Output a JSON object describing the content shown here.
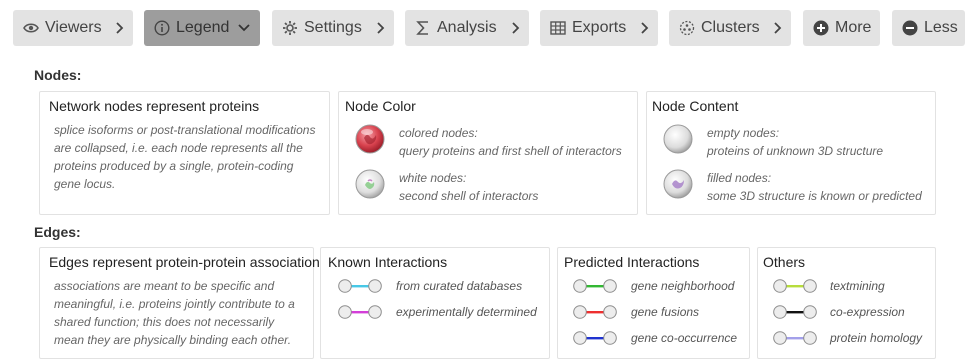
{
  "toolbar": {
    "buttons": [
      {
        "label": "Viewers",
        "icon": "eye-icon"
      },
      {
        "label": "Legend",
        "icon": "info-icon"
      },
      {
        "label": "Settings",
        "icon": "gear-icon"
      },
      {
        "label": "Analysis",
        "icon": "sigma-icon"
      },
      {
        "label": "Exports",
        "icon": "table-icon"
      },
      {
        "label": "Clusters",
        "icon": "cluster-icon"
      },
      {
        "label": "More",
        "icon": "plus-circle-icon"
      },
      {
        "label": "Less",
        "icon": "minus-circle-icon"
      }
    ],
    "active": "Legend"
  },
  "nodes": {
    "section_label": "Nodes:",
    "intro": {
      "title": "Network nodes represent proteins",
      "text": "splice isoforms or post-translational modifications are collapsed, i.e. each node represents all the proteins produced by a single, protein-coding gene locus."
    },
    "node_color": {
      "title": "Node Color",
      "items": [
        {
          "line1": "colored nodes:",
          "line2": "query proteins and first shell of interactors"
        },
        {
          "line1": "white nodes:",
          "line2": "second shell of interactors"
        }
      ]
    },
    "node_content": {
      "title": "Node Content",
      "items": [
        {
          "line1": "empty nodes:",
          "line2": "proteins of unknown 3D structure"
        },
        {
          "line1": "filled nodes:",
          "line2": "some 3D structure is known or predicted"
        }
      ]
    }
  },
  "edges": {
    "section_label": "Edges:",
    "intro": {
      "title": "Edges represent protein-protein associations",
      "text": "associations are meant to be specific and meaningful, i.e. proteins jointly contribute to a shared function; this does not necessarily mean they are physically binding each other."
    },
    "known": {
      "title": "Known Interactions",
      "items": [
        {
          "label": "from curated databases",
          "color": "#48c8e6"
        },
        {
          "label": "experimentally determined",
          "color": "#d33fd8"
        }
      ]
    },
    "predicted": {
      "title": "Predicted Interactions",
      "items": [
        {
          "label": "gene neighborhood",
          "color": "#33b833"
        },
        {
          "label": "gene fusions",
          "color": "#ee2f2f"
        },
        {
          "label": "gene co-occurrence",
          "color": "#2033d0"
        }
      ]
    },
    "others": {
      "title": "Others",
      "items": [
        {
          "label": "textmining",
          "color": "#b7dd3c"
        },
        {
          "label": "co-expression",
          "color": "#111111"
        },
        {
          "label": "protein homology",
          "color": "#a3a0ea"
        }
      ]
    }
  }
}
